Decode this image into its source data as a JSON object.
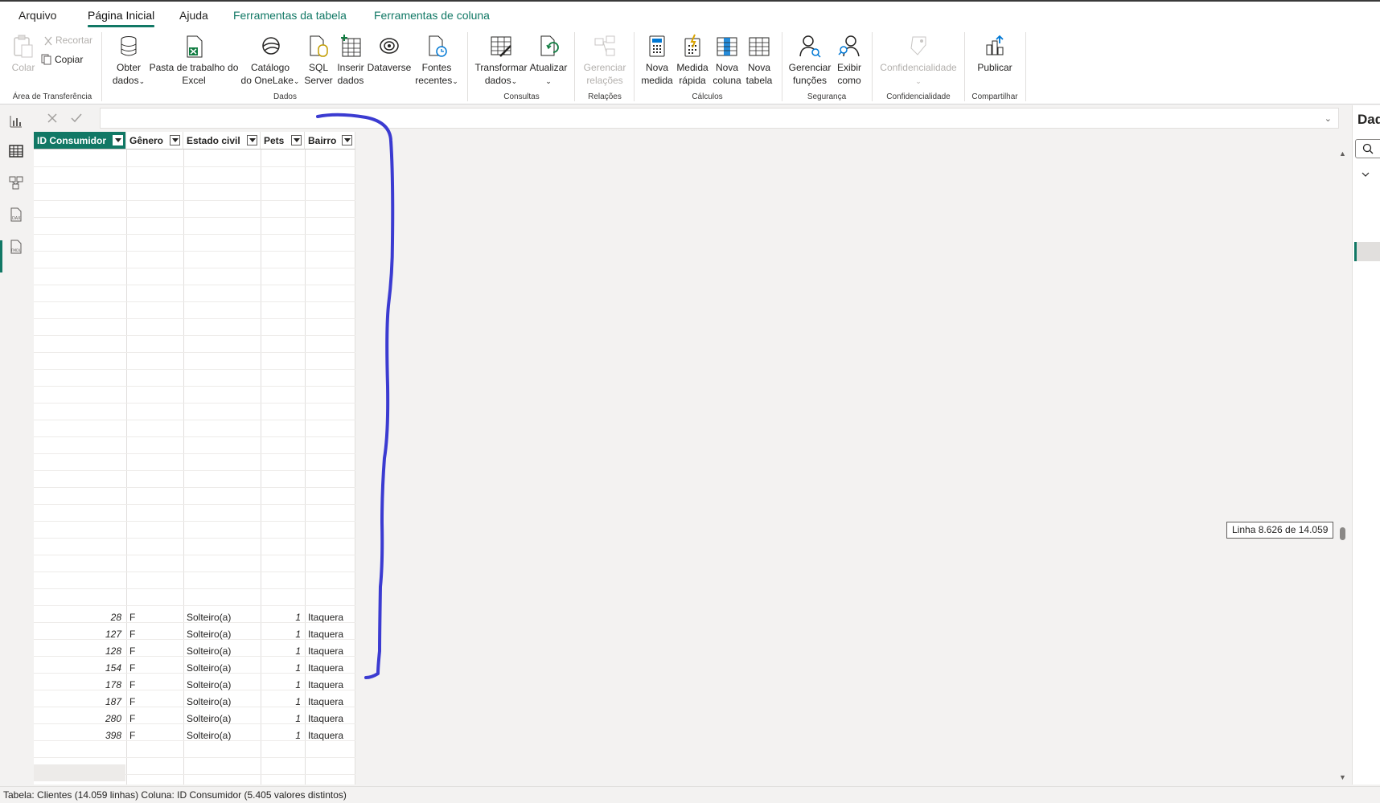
{
  "tabs": {
    "file": "Arquivo",
    "home": "Página Inicial",
    "help": "Ajuda",
    "table_tools": "Ferramentas da tabela",
    "column_tools": "Ferramentas de coluna"
  },
  "ribbon": {
    "clipboard": {
      "paste": "Colar",
      "cut": "Recortar",
      "copy": "Copiar",
      "group": "Área de Transferência"
    },
    "data": {
      "get_data_1": "Obter",
      "get_data_2": "dados",
      "excel_1": "Pasta de trabalho do",
      "excel_2": "Excel",
      "onelake_1": "Catálogo",
      "onelake_2": "do OneLake",
      "sql_1": "SQL",
      "sql_2": "Server",
      "enter_1": "Inserir",
      "enter_2": "dados",
      "dataverse": "Dataverse",
      "recent_1": "Fontes",
      "recent_2": "recentes",
      "group": "Dados"
    },
    "queries": {
      "transform_1": "Transformar",
      "transform_2": "dados",
      "refresh": "Atualizar",
      "group": "Consultas"
    },
    "relations": {
      "manage_1": "Gerenciar",
      "manage_2": "relações",
      "group": "Relações"
    },
    "calculations": {
      "measure_1": "Nova",
      "measure_2": "medida",
      "quick_1": "Medida",
      "quick_2": "rápida",
      "column_1": "Nova",
      "column_2": "coluna",
      "table_1": "Nova",
      "table_2": "tabela",
      "group": "Cálculos"
    },
    "security": {
      "roles_1": "Gerenciar",
      "roles_2": "funções",
      "viewas_1": "Exibir",
      "viewas_2": "como",
      "group": "Segurança"
    },
    "sensitivity": {
      "label": "Confidencialidade",
      "group": "Confidencialidade"
    },
    "share": {
      "publish": "Publicar",
      "group": "Compartilhar"
    }
  },
  "table": {
    "columns": [
      "ID Consumidor",
      "Gênero",
      "Estado civil",
      "Pets",
      "Bairro"
    ],
    "rows": [
      [
        "28",
        "F",
        "Solteiro(a)",
        "1",
        "Itaquera"
      ],
      [
        "127",
        "F",
        "Solteiro(a)",
        "1",
        "Itaquera"
      ],
      [
        "128",
        "F",
        "Solteiro(a)",
        "1",
        "Itaquera"
      ],
      [
        "154",
        "F",
        "Solteiro(a)",
        "1",
        "Itaquera"
      ],
      [
        "178",
        "F",
        "Solteiro(a)",
        "1",
        "Itaquera"
      ],
      [
        "187",
        "F",
        "Solteiro(a)",
        "1",
        "Itaquera"
      ],
      [
        "280",
        "F",
        "Solteiro(a)",
        "1",
        "Itaquera"
      ],
      [
        "398",
        "F",
        "Solteiro(a)",
        "1",
        "Itaquera"
      ]
    ]
  },
  "scroll_tooltip": "Linha 8.626 de 14.059",
  "right_pane": {
    "title": "Dad"
  },
  "status": "Tabela: Clientes (14.059 linhas) Coluna: ID Consumidor (5.405 valores distintos)",
  "colors": {
    "accent": "#117865",
    "annotation": "#3b3bd1"
  }
}
